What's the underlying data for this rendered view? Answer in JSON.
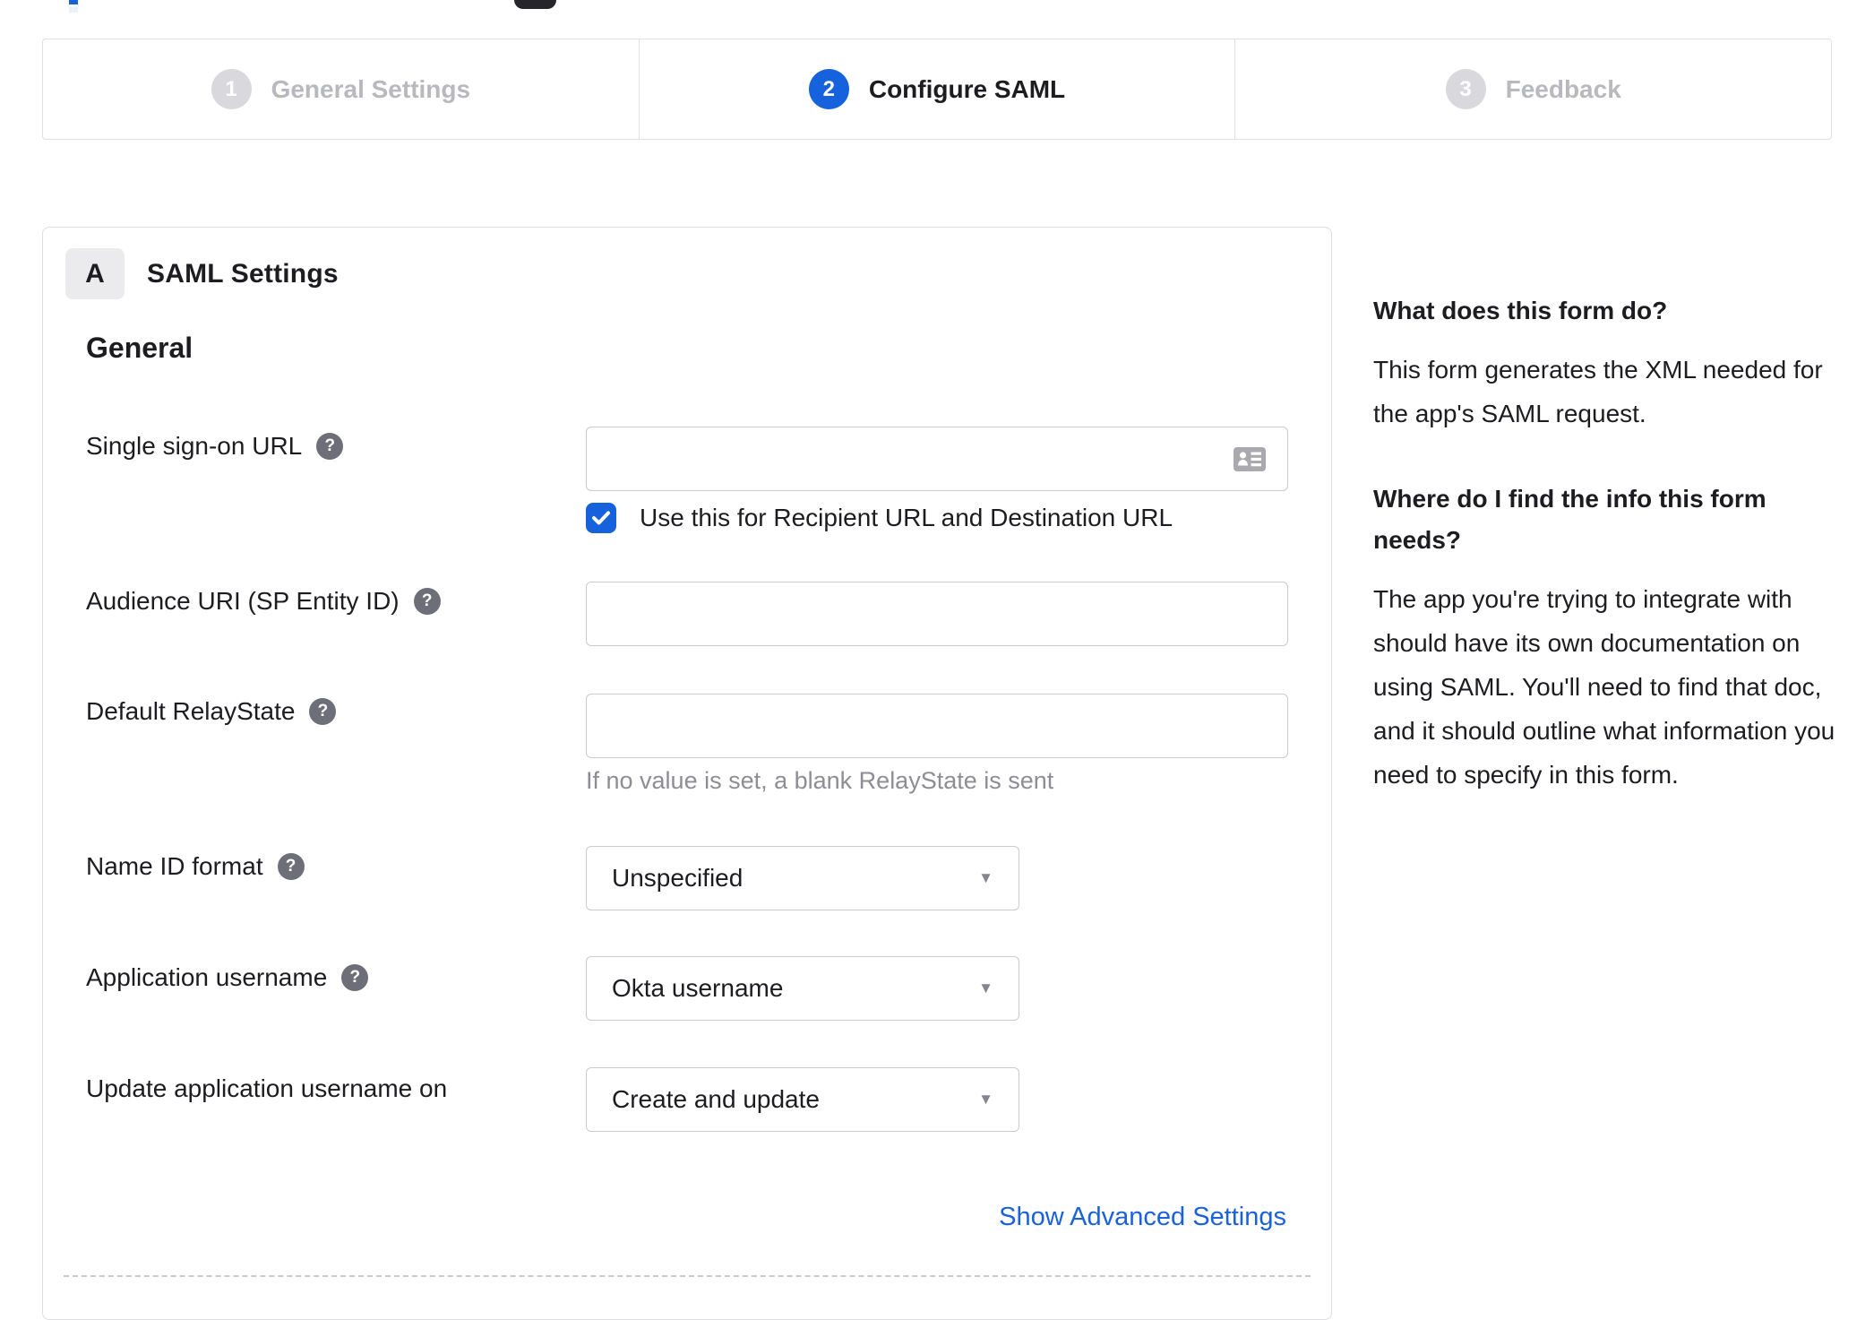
{
  "stepper": {
    "steps": [
      {
        "number": "1",
        "label": "General Settings",
        "state": "inactive"
      },
      {
        "number": "2",
        "label": "Configure SAML",
        "state": "active"
      },
      {
        "number": "3",
        "label": "Feedback",
        "state": "inactive"
      }
    ]
  },
  "panel": {
    "badge": "A",
    "title": "SAML Settings",
    "section": "General",
    "fields": [
      {
        "label": "Single sign-on URL",
        "has_help": true,
        "value": "",
        "checkbox_label": "Use this for Recipient URL and Destination URL",
        "checkbox_checked": true
      },
      {
        "label": "Audience URI (SP Entity ID)",
        "has_help": true,
        "value": ""
      },
      {
        "label": "Default RelayState",
        "has_help": true,
        "value": "",
        "hint": "If no value is set, a blank RelayState is sent"
      },
      {
        "label": "Name ID format",
        "has_help": true,
        "selected": "Unspecified"
      },
      {
        "label": "Application username",
        "has_help": true,
        "selected": "Okta username"
      },
      {
        "label": "Update application username on",
        "has_help": false,
        "selected": "Create and update"
      }
    ],
    "advanced_link": "Show Advanced Settings"
  },
  "sidebar": {
    "q1": "What does this form do?",
    "a1": "This form generates the XML needed for the app's SAML request.",
    "q2": "Where do I find the info this form needs?",
    "a2": "The app you're trying to integrate with should have its own documentation on using SAML. You'll need to find that doc, and it should outline what information you need to specify in this form."
  },
  "icons": {
    "help_glyph": "?",
    "caret_glyph": "▼"
  },
  "colors": {
    "accent": "#1662dd",
    "link": "#1a62dc",
    "text": "#1d1d21",
    "inactive_circle": "#d9d9dd",
    "inactive_text": "#b8b8bf",
    "hint_text": "#8d8d94",
    "border": "#c9c9ce"
  }
}
